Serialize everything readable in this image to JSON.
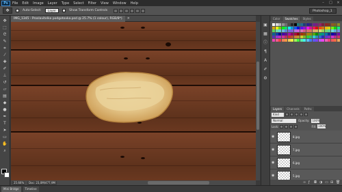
{
  "menubar": {
    "logo": "Ps",
    "items": [
      "File",
      "Edit",
      "Image",
      "Layer",
      "Type",
      "Select",
      "Filter",
      "View",
      "Window",
      "Help"
    ],
    "window_controls": [
      "–",
      "□",
      "×"
    ]
  },
  "options": {
    "auto_select_label": "Auto-Select:",
    "auto_select_value": "Layer",
    "show_transform_label": "Show Transform Controls",
    "workspace": "Photoshop_1"
  },
  "document": {
    "tab_label": "IMG_1345 - Proslavitelka podgotovka.psd @ 25.7% (1 colour), RGB/8*)",
    "close": "×",
    "zoom": "25.66%",
    "doc_info": "Doc: 23,0M/477,9M"
  },
  "bottom_tabs": [
    "Mini Bridge",
    "Timeline"
  ],
  "panels": {
    "top_tabs": [
      "Color",
      "Swatches",
      "Styles"
    ],
    "layers_tabs": [
      "Layers",
      "Channels",
      "Paths"
    ],
    "kind": "Kind",
    "blend_mode": "Normal",
    "opacity_label": "Opacity:",
    "opacity_value": "100%",
    "lock_label": "Lock:",
    "fill_label": "Fill:",
    "fill_value": "100%",
    "layers": [
      {
        "name": "8.jpg"
      },
      {
        "name": "7.jpg"
      },
      {
        "name": "6.jpg"
      },
      {
        "name": "5.jpg"
      }
    ]
  },
  "colors": {
    "wood": "#6a3a22",
    "panel": "#535353",
    "menubar": "#2c2c2c"
  }
}
